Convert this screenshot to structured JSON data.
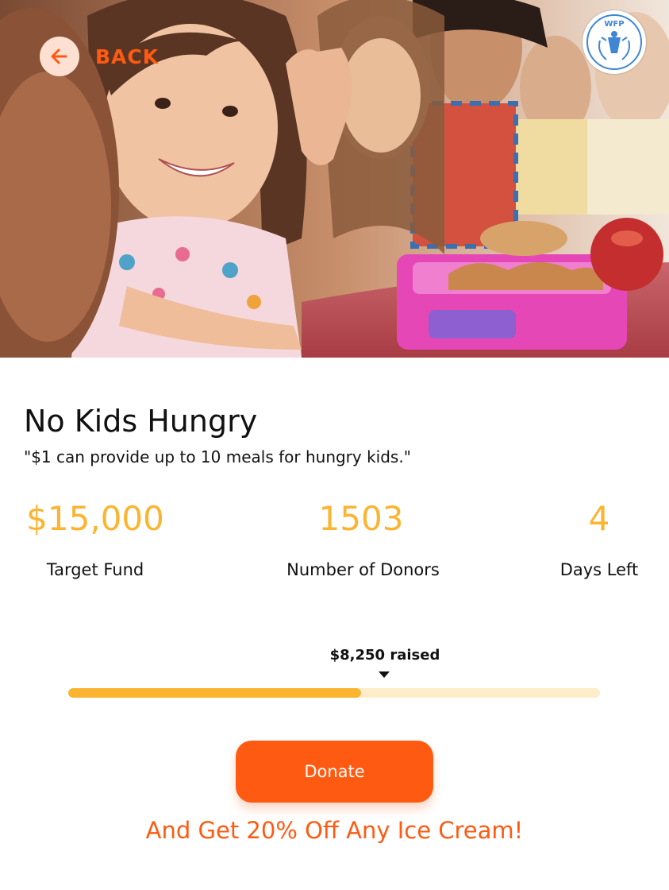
{
  "header": {
    "back_label": "BACK",
    "logo_text": "WFP"
  },
  "campaign": {
    "title": "No Kids Hungry",
    "quote": "\"$1 can provide up to 10 meals for hungry kids.\""
  },
  "stats": [
    {
      "value": "$15,000",
      "label": "Target Fund"
    },
    {
      "value": "1503",
      "label": "Number of Donors"
    },
    {
      "value": "4",
      "label": "Days Left"
    }
  ],
  "progress": {
    "raised_label": "$8,250 raised",
    "fraction": 0.55
  },
  "actions": {
    "donate_label": "Donate",
    "promo": "And Get 20% Off Any Ice Cream!"
  },
  "colors": {
    "accent": "#ff5a12",
    "highlight": "#fbb430",
    "track": "#fdedc9"
  },
  "icons": {
    "back": "arrow-left-icon",
    "logo": "wfp-logo-icon",
    "hero": "children-eating-lunch-photo"
  }
}
